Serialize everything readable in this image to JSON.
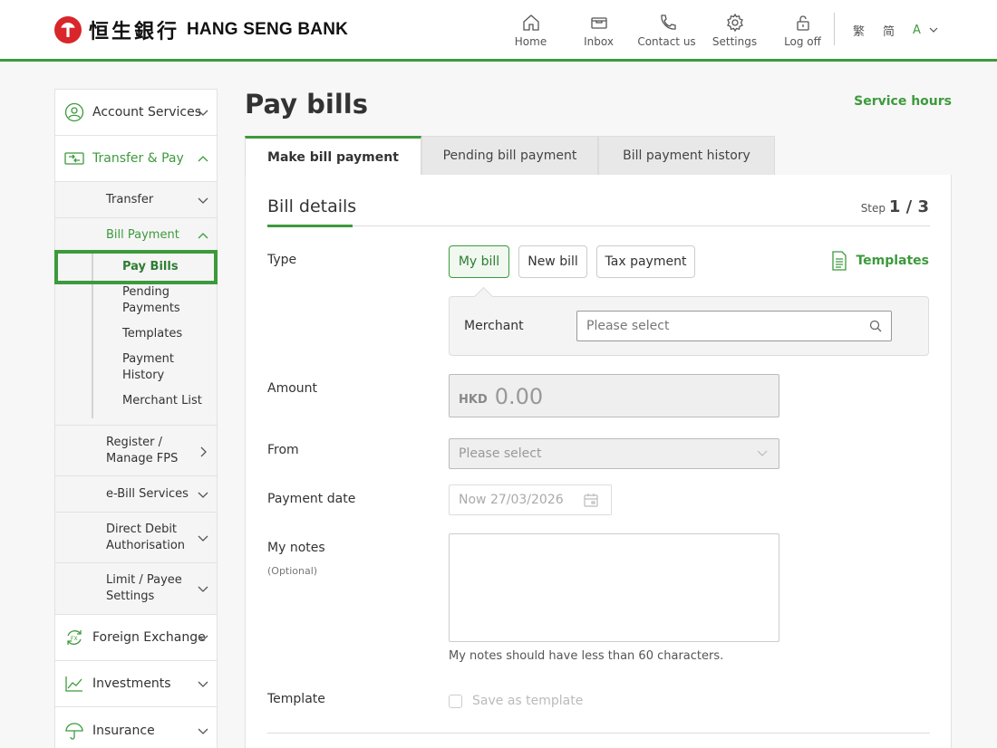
{
  "brand": {
    "name_cn": "恒生銀行",
    "name_en": "HANG SENG BANK"
  },
  "nav": [
    {
      "label": "Home",
      "icon": "home-icon"
    },
    {
      "label": "Inbox",
      "icon": "inbox-icon"
    },
    {
      "label": "Contact us",
      "icon": "phone-icon"
    },
    {
      "label": "Settings",
      "icon": "gear-icon"
    },
    {
      "label": "Log off",
      "icon": "lock-icon"
    }
  ],
  "lang": {
    "trad": "繁",
    "simp": "简",
    "font_size": "A"
  },
  "sidebar": {
    "account_services": "Account Services",
    "transfer_pay": "Transfer & Pay",
    "transfer": "Transfer",
    "bill_payment": "Bill Payment",
    "bill_items": [
      "Pay Bills",
      "Pending Payments",
      "Templates",
      "Payment History",
      "Merchant List"
    ],
    "register_fps": "Register / Manage FPS",
    "ebill": "e-Bill Services",
    "direct_debit": "Direct Debit Authorisation",
    "limit_payee": "Limit / Payee Settings",
    "forex": "Foreign Exchange",
    "investments": "Investments",
    "insurance": "Insurance"
  },
  "page": {
    "title": "Pay bills",
    "service_hours": "Service hours"
  },
  "tabs": [
    "Make bill payment",
    "Pending bill payment",
    "Bill payment history"
  ],
  "form": {
    "section_title": "Bill details",
    "step_label": "Step",
    "step_value": "1 / 3",
    "type_label": "Type",
    "type_options": [
      "My bill",
      "New bill",
      "Tax payment"
    ],
    "templates_link": "Templates",
    "merchant_label": "Merchant",
    "merchant_placeholder": "Please select",
    "amount_label": "Amount",
    "currency": "HKD",
    "amount_value": "0.00",
    "from_label": "From",
    "from_placeholder": "Please select",
    "date_label": "Payment date",
    "date_value": "Now 27/03/2026",
    "notes_label": "My notes",
    "notes_optional": "(Optional)",
    "notes_hint": "My notes should have less than 60 characters.",
    "template_label": "Template",
    "save_template": "Save as template"
  },
  "colors": {
    "accent": "#3c9a3c",
    "brand_red": "#d8262b"
  }
}
